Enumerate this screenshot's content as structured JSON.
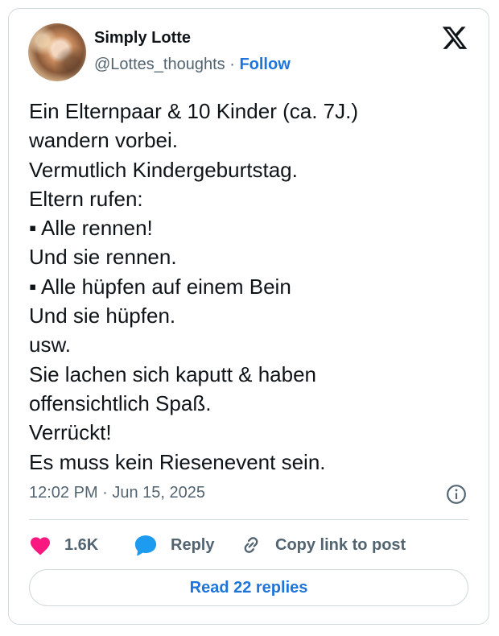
{
  "author": {
    "name": "Simply Lotte",
    "handle": "@Lottes_thoughts",
    "separator": "·",
    "follow_label": "Follow"
  },
  "tweet": {
    "lines": [
      "Ein Elternpaar & 10 Kinder (ca. 7J.)",
      "wandern vorbei.",
      "Vermutlich Kindergeburtstag.",
      "Eltern rufen:",
      "▪ Alle rennen!",
      "Und sie rennen.",
      "▪ Alle hüpfen auf einem Bein",
      "Und sie hüpfen.",
      "usw.",
      "Sie lachen sich kaputt & haben",
      "offensichtlich Spaß.",
      "Verrückt!",
      "Es muss kein Riesenevent sein."
    ],
    "timestamp": "12:02 PM · Jun 15, 2025"
  },
  "actions": {
    "like_count": "1.6K",
    "reply_label": "Reply",
    "copy_label": "Copy link to post"
  },
  "read_replies_label": "Read 22 replies",
  "icons": [
    "x-logo-icon",
    "info-icon",
    "heart-icon",
    "reply-bubble-icon",
    "link-icon"
  ],
  "colors": {
    "like": "#f91880",
    "reply": "#1d9bf0",
    "link": "#1d74d9",
    "muted": "#536471",
    "border": "#cfd9de"
  }
}
